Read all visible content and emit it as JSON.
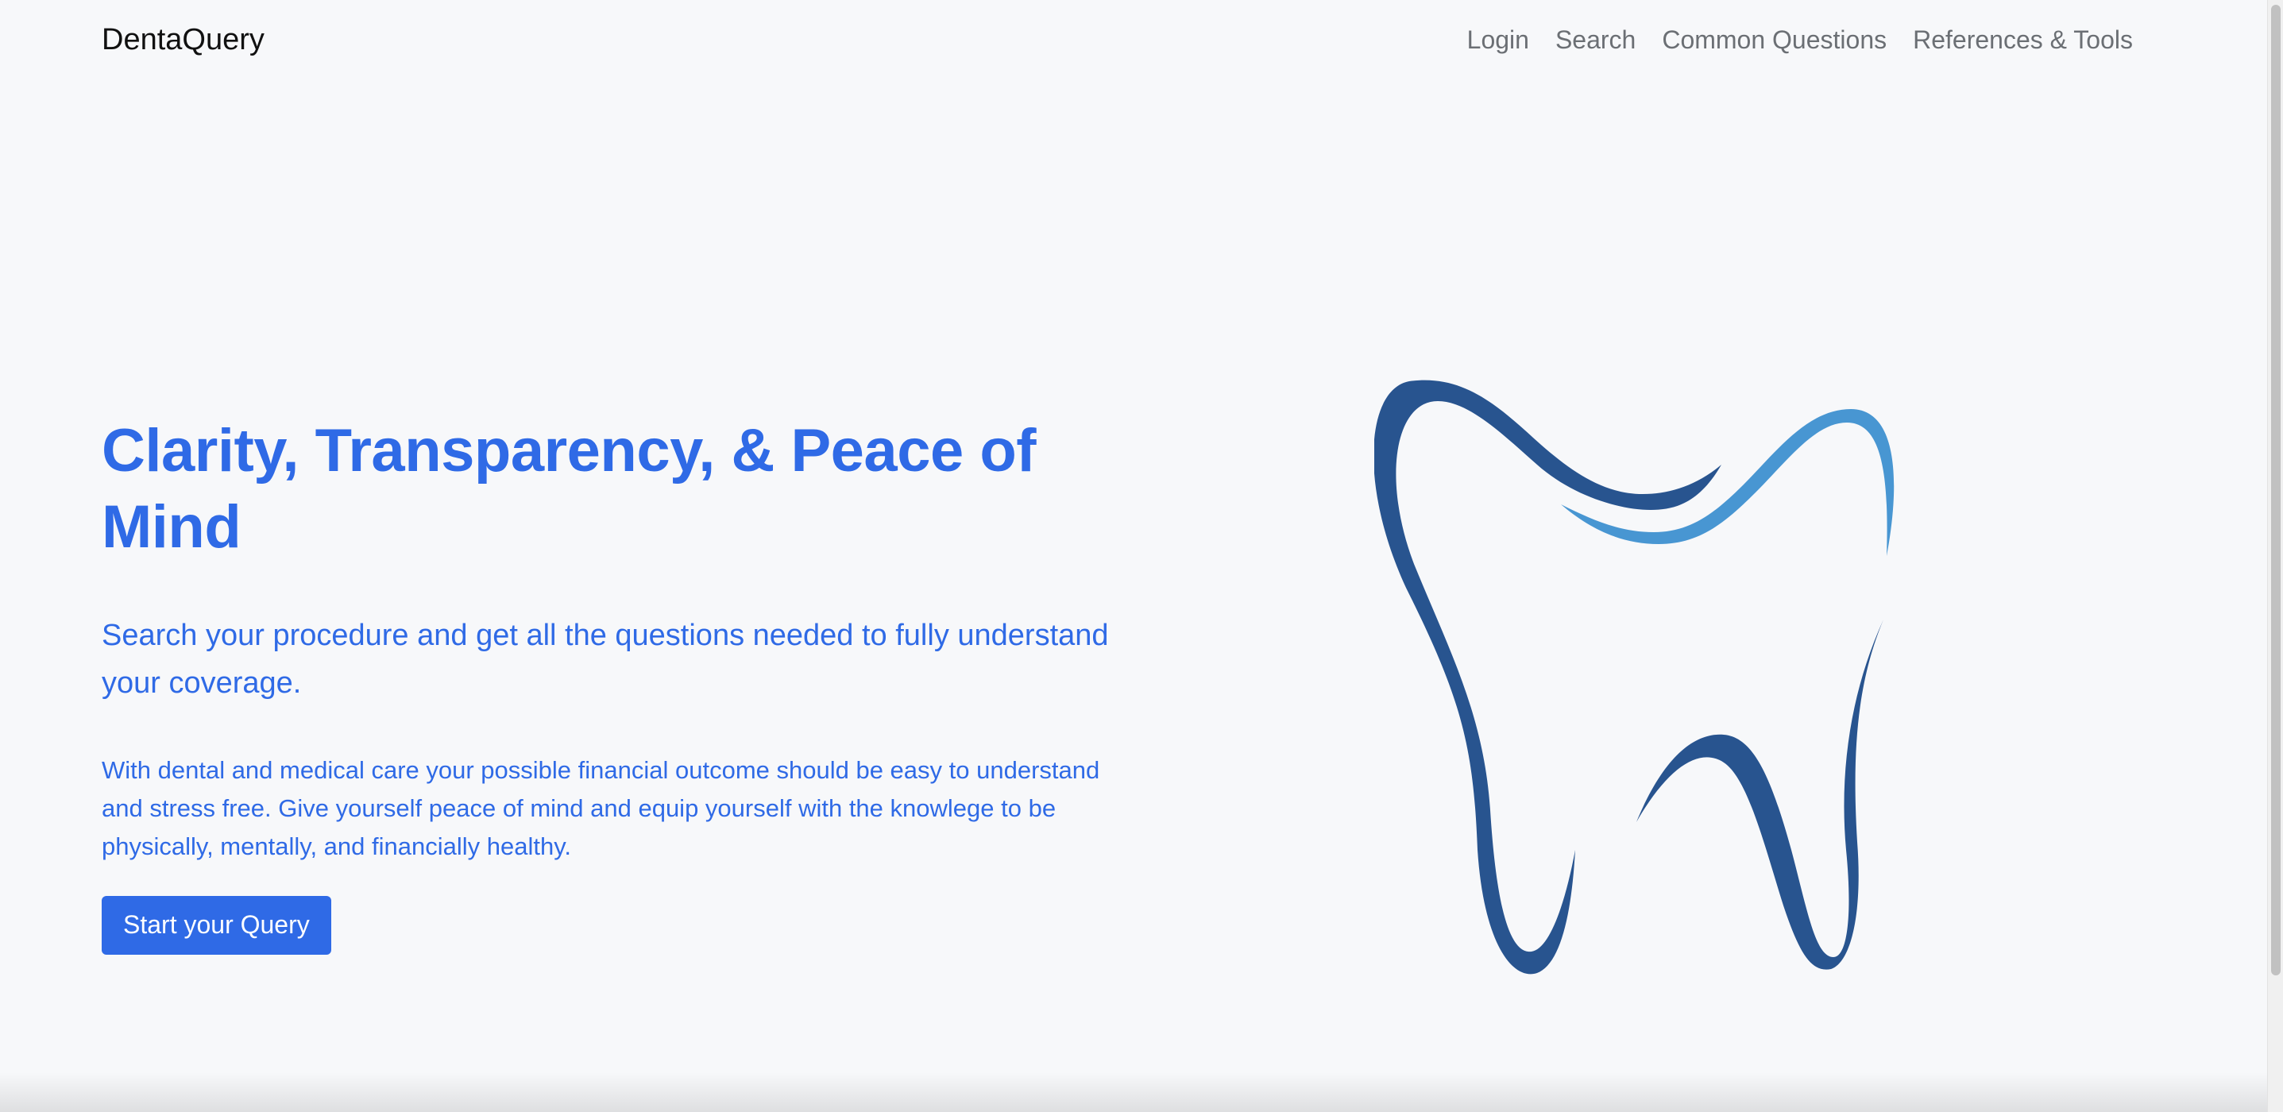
{
  "navbar": {
    "brand": "DentaQuery",
    "links": [
      {
        "label": "Login"
      },
      {
        "label": "Search"
      },
      {
        "label": "Common Questions"
      },
      {
        "label": "References & Tools"
      }
    ]
  },
  "hero": {
    "title": "Clarity, Transparency, & Peace of Mind",
    "lead": "Search your procedure and get all the questions needed to fully understand your coverage.",
    "body": "With dental and medical care your possible financial outcome should be easy to understand and stress free. Give yourself peace of mind and equip yourself with the knowlege to be physically, mentally, and financially healthy.",
    "cta_label": "Start your Query"
  },
  "illustration": {
    "icon": "tooth-icon",
    "colors": {
      "dark": "#28548f",
      "light": "#4896d2"
    }
  },
  "theme": {
    "accent": "#2f6ae6",
    "background": "#f7f8fa",
    "nav_text": "#6b6f74"
  }
}
